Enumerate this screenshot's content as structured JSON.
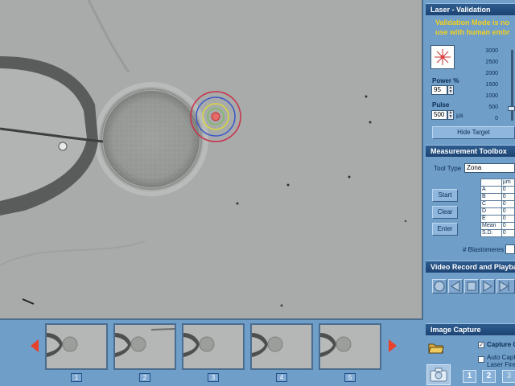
{
  "laser": {
    "title": "Laser - Validation",
    "warning_line1": "Validation Mode is no",
    "warning_line2": "use with human embr",
    "power_label": "Power %",
    "power_value": "95",
    "pulse_label": "Pulse",
    "pulse_value": "500",
    "pulse_unit": "µs",
    "scale_ticks": [
      "3000",
      "2500",
      "2000",
      "1500",
      "1000",
      "500",
      "0"
    ],
    "slider_value": 500,
    "hide_target_label": "Hide Target"
  },
  "measurement": {
    "title": "Measurement Toolbox",
    "tool_type_label": "Tool Type",
    "tool_type_value": "Zona",
    "start_label": "Start",
    "clear_label": "Clear",
    "enter_label": "Enter",
    "table_header": "µm",
    "rows": [
      {
        "label": "A",
        "value": "0"
      },
      {
        "label": "B",
        "value": "0"
      },
      {
        "label": "C",
        "value": "0"
      },
      {
        "label": "D",
        "value": "0"
      },
      {
        "label": "E",
        "value": "0"
      },
      {
        "label": "Mean",
        "value": "0"
      },
      {
        "label": "S.D.",
        "value": "0"
      }
    ],
    "blastomeres_label": "# Blastomeres"
  },
  "video": {
    "title": "Video Record and Playback"
  },
  "capture": {
    "title": "Image Capture",
    "capture_on_label": "Capture O",
    "auto_capture_line1": "Auto Capt",
    "auto_capture_line2": "Laser Fire",
    "capture_on_checked": true,
    "auto_capture_checked": false,
    "pages": [
      "1",
      "2",
      "3"
    ]
  },
  "thumbnails": [
    "1",
    "2",
    "3",
    "4",
    "5"
  ],
  "colors": {
    "panel_bg": "#6f9ec9",
    "title_bar": "#1d4474",
    "warning": "#f2d020",
    "arrow": "#e8412c"
  }
}
